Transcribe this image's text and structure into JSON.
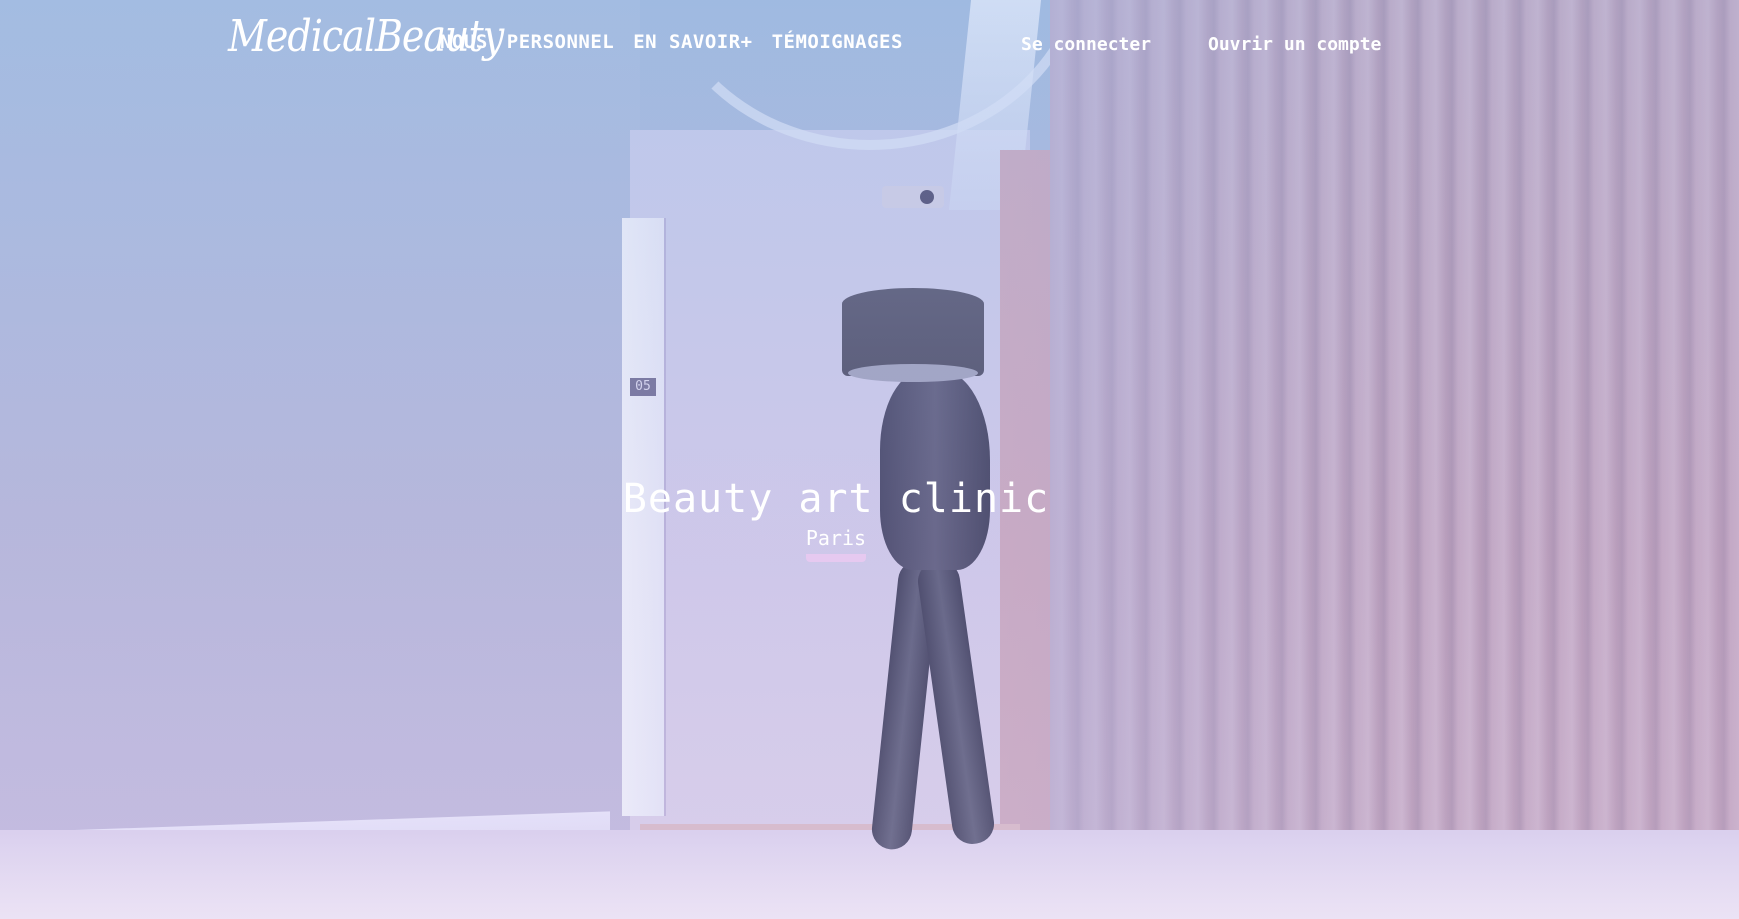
{
  "brand": {
    "logo_text": "MedicalBeauty"
  },
  "nav": {
    "items": [
      {
        "label": "NOUS"
      },
      {
        "label": "PERSONNEL"
      },
      {
        "label": "EN SAVOIR+"
      },
      {
        "label": "TÉMOIGNAGES"
      }
    ],
    "login_label": "Se connecter",
    "signup_label": "Ouvrir un compte"
  },
  "hero": {
    "title": "Beauty art clinic",
    "subtitle": "Paris",
    "door_number": "05"
  },
  "colors": {
    "text": "#ffffff",
    "subtitle_underline": "#e6c9f0",
    "overlay_top": "#9fb9df",
    "overlay_bottom": "#d8c7e3"
  }
}
